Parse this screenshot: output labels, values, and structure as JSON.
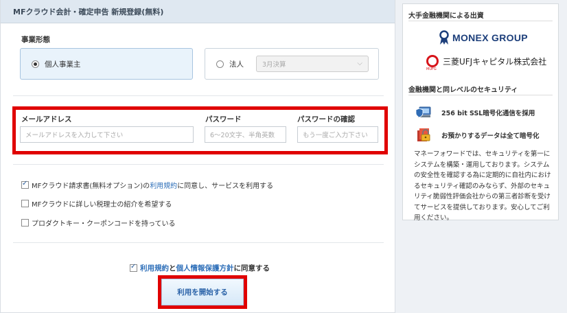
{
  "header": {
    "title": "MFクラウド会計・確定申告 新規登録(無料)"
  },
  "business_type": {
    "label": "事業形態",
    "option_individual": "個人事業主",
    "option_corporate": "法人",
    "fiscal_select_value": "3月決算"
  },
  "credentials": {
    "email_label": "メールアドレス",
    "email_placeholder": "メールアドレスを入力して下さい",
    "password_label": "パスワード",
    "password_placeholder": "6〜20文字、半角英数",
    "confirm_label": "パスワードの確認",
    "confirm_placeholder": "もう一度ご入力下さい"
  },
  "options": {
    "invoice_pre": "MFクラウド請求書(無料オプション)の",
    "invoice_link": "利用規約",
    "invoice_post": "に同意し、サービスを利用する",
    "invoice_checked": true,
    "accountant": "MFクラウドに詳しい税理士の紹介を希望する",
    "accountant_checked": false,
    "product_key": "プロダクトキー・クーポンコードを持っている",
    "product_key_checked": false
  },
  "agreement": {
    "terms_link": "利用規約",
    "and": "と",
    "privacy_link": "個人情報保護方針",
    "suffix": "に同意する",
    "checked": true
  },
  "submit_label": "利用を開始する",
  "sidebar": {
    "investors_title": "大手金融機関による出資",
    "monex_name": "MONEX GROUP",
    "mufg_name": "三菱UFJキャピタル株式会社",
    "mufg_mark_text": "MUFG",
    "security_title": "金融機関と同レベルのセキュリティ",
    "ssl_text": "256 bit SSL暗号化通信を採用",
    "encrypt_text": "お預かりするデータは全て暗号化",
    "description": "マネーフォワードでは、セキュリティを第一にシステムを構築・運用しております。システムの安全性を確認する為に定期的に自社内におけるセキュリティ確認のみならず、外部のセキュリティ脆弱性評価会社からの第三者診断を受けてサービスを提供しております。安心してご利用ください。"
  },
  "colors": {
    "highlight_red": "#e00000",
    "link_blue": "#2e6fb9",
    "header_bg": "#dfe8f1"
  }
}
